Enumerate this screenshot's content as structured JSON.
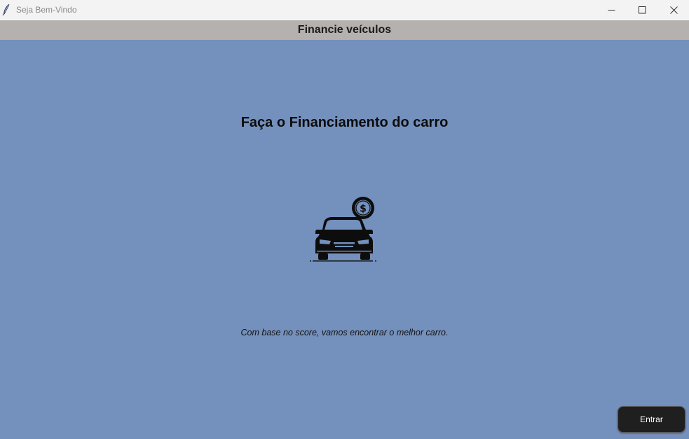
{
  "window": {
    "title": "Seja Bem-Vindo",
    "icon": "feather-icon",
    "controls": [
      "minimize-icon",
      "maximize-icon",
      "close-icon"
    ]
  },
  "header": {
    "title": "Financie veículos"
  },
  "main": {
    "heading": "Faça o Financiamento do carro",
    "illustration": "car-with-dollar-coin-icon",
    "subtitle": "Com base no score, vamos encontrar o melhor carro."
  },
  "actions": {
    "enter_label": "Entrar"
  },
  "colors": {
    "background": "#7490bc",
    "header_bar": "#b5b1ae",
    "titlebar": "#f3f3f3",
    "button": "#1f1f1f"
  }
}
